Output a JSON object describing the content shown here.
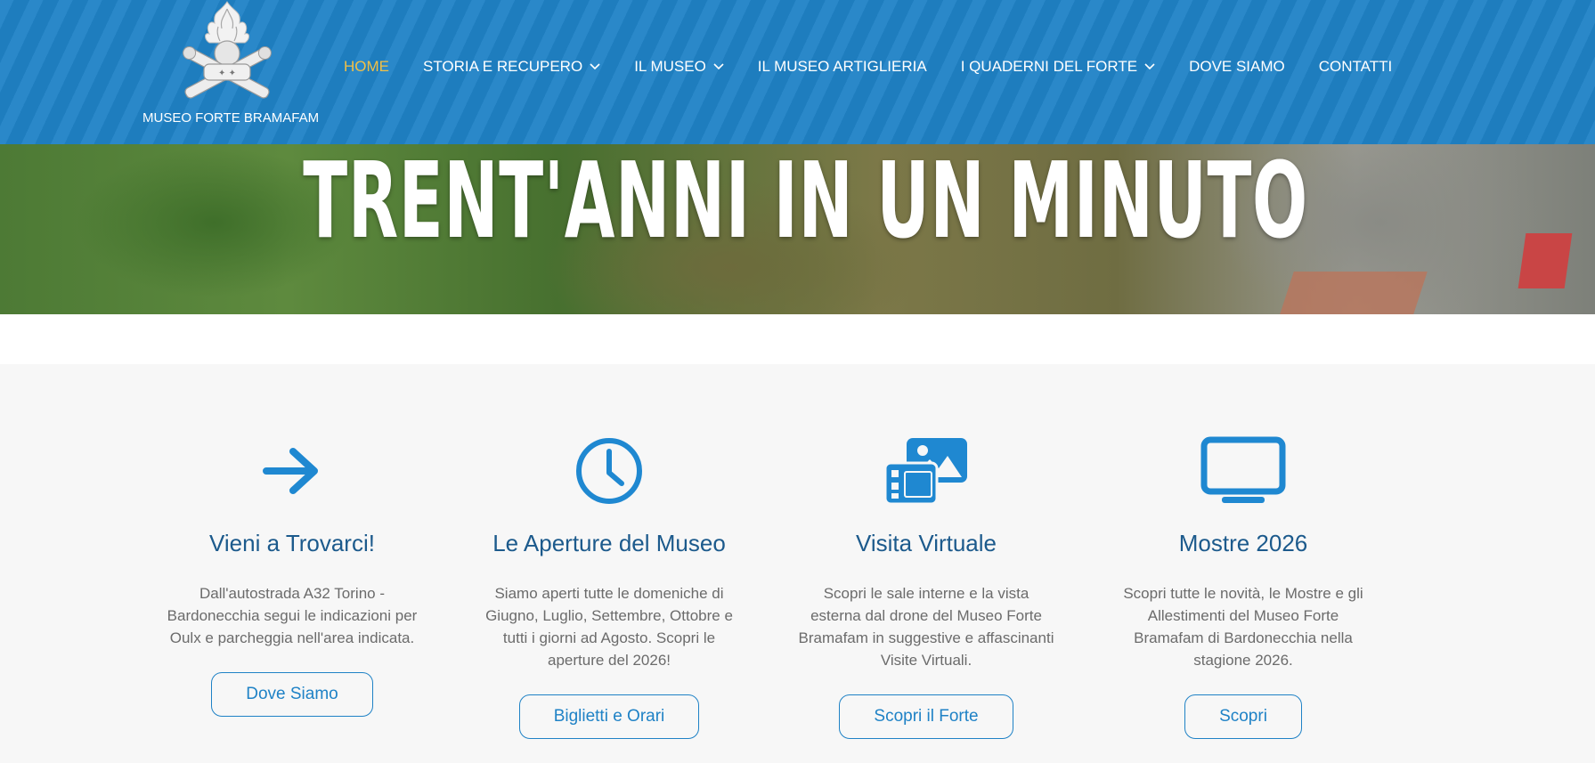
{
  "logo": {
    "text": "MUSEO FORTE BRAMAFAM"
  },
  "nav": {
    "items": [
      {
        "label": "HOME",
        "active": true,
        "dropdown": false
      },
      {
        "label": "STORIA E RECUPERO",
        "active": false,
        "dropdown": true
      },
      {
        "label": "IL MUSEO",
        "active": false,
        "dropdown": true
      },
      {
        "label": "IL MUSEO ARTIGLIERIA",
        "active": false,
        "dropdown": false
      },
      {
        "label": "I QUADERNI DEL FORTE",
        "active": false,
        "dropdown": true
      },
      {
        "label": "DOVE SIAMO",
        "active": false,
        "dropdown": false
      },
      {
        "label": "CONTATTI",
        "active": false,
        "dropdown": false
      }
    ]
  },
  "hero": {
    "title": "TRENT'ANNI IN UN MINUTO"
  },
  "features": [
    {
      "icon": "arrow-right-icon",
      "title": "Vieni a Trovarci!",
      "text": "Dall'autostrada A32 Torino - Bardonecchia segui le indicazioni per Oulx e parcheggia nell'area indicata.",
      "button": "Dove Siamo"
    },
    {
      "icon": "clock-icon",
      "title": "Le Aperture del Museo",
      "text": "Siamo aperti tutte le domeniche di Giugno, Luglio, Settembre, Ottobre e tutti i giorni ad Agosto. Scopri le aperture del 2026!",
      "button": "Biglietti e Orari"
    },
    {
      "icon": "photo-video-icon",
      "title": "Visita Virtuale",
      "text": "Scopri le sale interne e la vista esterna dal drone del Museo Forte Bramafam in suggestive e affascinanti Visite Virtuali.",
      "button": "Scopri il Forte"
    },
    {
      "icon": "monitor-icon",
      "title": "Mostre 2026",
      "text": "Scopri tutte le novità, le Mostre e gli Allestimenti del Museo Forte Bramafam di Bardonecchia nella stagione 2026.",
      "button": "Scopri"
    }
  ],
  "colors": {
    "header_blue": "#1f82c6",
    "active_nav": "#f2c046",
    "heading": "#1c5a8c",
    "icon_blue": "#1f88d1",
    "body_text": "#6b6b6b",
    "section_bg": "#f7f7f7"
  }
}
